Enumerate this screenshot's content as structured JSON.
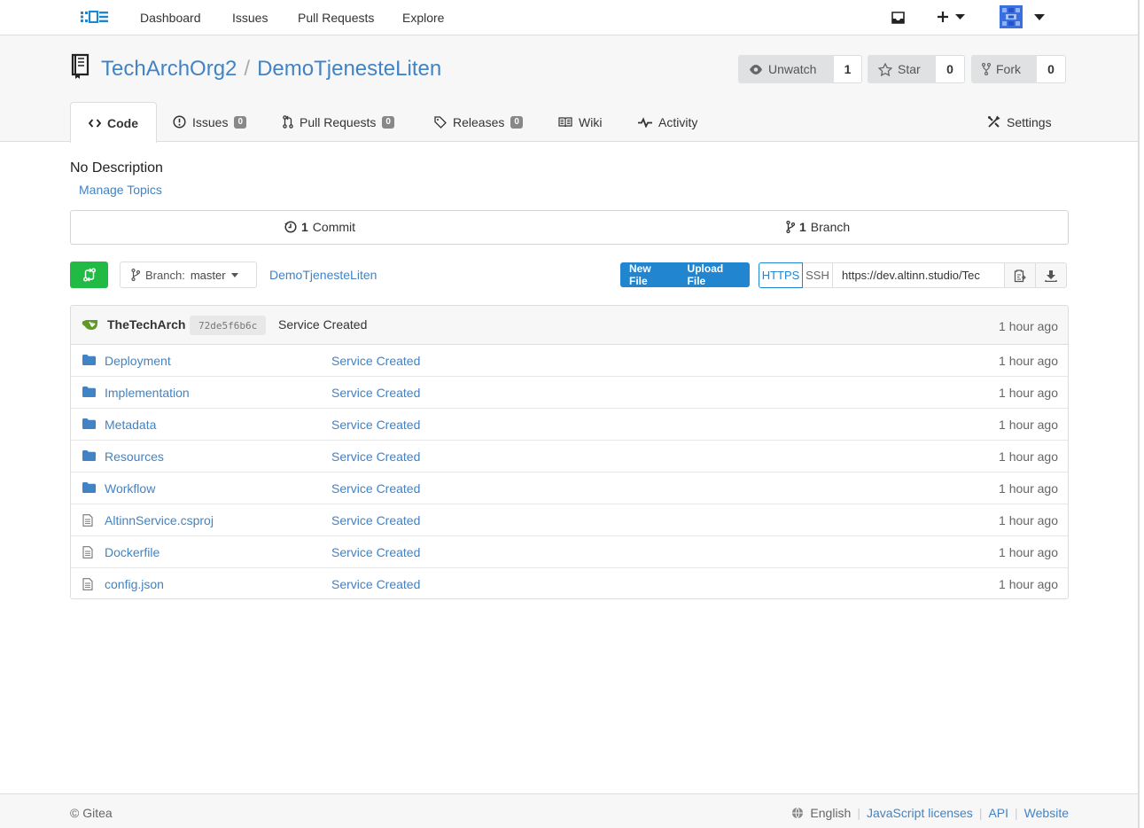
{
  "nav": {
    "items": [
      "Dashboard",
      "Issues",
      "Pull Requests",
      "Explore"
    ]
  },
  "repo": {
    "owner": "TechArchOrg2",
    "separator": "/",
    "name": "DemoTjenesteLiten",
    "watch_label": "Unwatch",
    "watch_count": "1",
    "star_label": "Star",
    "star_count": "0",
    "fork_label": "Fork",
    "fork_count": "0"
  },
  "tabs": {
    "code": "Code",
    "issues": "Issues",
    "issues_count": "0",
    "pulls": "Pull Requests",
    "pulls_count": "0",
    "releases": "Releases",
    "releases_count": "0",
    "wiki": "Wiki",
    "activity": "Activity",
    "settings": "Settings"
  },
  "description": "No Description",
  "manage_topics": "Manage Topics",
  "stats": {
    "commits_num": "1",
    "commits_label": "Commit",
    "branches_num": "1",
    "branches_label": "Branch"
  },
  "toolbar": {
    "branch_prefix": "Branch:",
    "branch_name": "master",
    "repo_crumb": "DemoTjenesteLiten",
    "new_file": "New File",
    "upload_file": "Upload File",
    "https": "HTTPS",
    "ssh": "SSH",
    "clone_url": "https://dev.altinn.studio/Tec"
  },
  "latest_commit": {
    "author": "TheTechArch",
    "sha": "72de5f6b6c",
    "message": "Service Created",
    "time": "1 hour ago"
  },
  "files": [
    {
      "name": "Deployment",
      "type": "folder",
      "message": "Service Created",
      "time": "1 hour ago"
    },
    {
      "name": "Implementation",
      "type": "folder",
      "message": "Service Created",
      "time": "1 hour ago"
    },
    {
      "name": "Metadata",
      "type": "folder",
      "message": "Service Created",
      "time": "1 hour ago"
    },
    {
      "name": "Resources",
      "type": "folder",
      "message": "Service Created",
      "time": "1 hour ago"
    },
    {
      "name": "Workflow",
      "type": "folder",
      "message": "Service Created",
      "time": "1 hour ago"
    },
    {
      "name": "AltinnService.csproj",
      "type": "file",
      "message": "Service Created",
      "time": "1 hour ago"
    },
    {
      "name": "Dockerfile",
      "type": "file",
      "message": "Service Created",
      "time": "1 hour ago"
    },
    {
      "name": "config.json",
      "type": "file",
      "message": "Service Created",
      "time": "1 hour ago"
    }
  ],
  "footer": {
    "copyright": "© Gitea",
    "language": "English",
    "links": [
      "JavaScript licenses",
      "API",
      "Website"
    ]
  },
  "colors": {
    "link": "#4183c4",
    "primary": "#2185d0",
    "green": "#21ba45",
    "folder": "#4183c4"
  }
}
